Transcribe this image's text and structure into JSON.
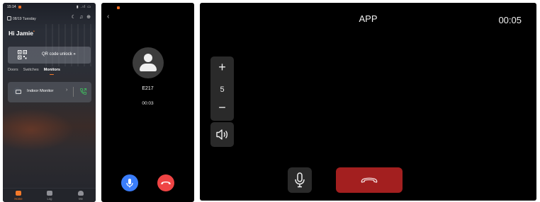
{
  "home": {
    "status_time": "15:14",
    "date": "08/19 Tuesday",
    "greeting": "Hi Jamie",
    "qr_label": "QR code unlock »",
    "tabs": [
      {
        "label": "Doors",
        "active": false
      },
      {
        "label": "Switches",
        "active": false
      },
      {
        "label": "Monitors",
        "active": true
      }
    ],
    "monitor": {
      "name": "Indoor Monitor",
      "chevron": "›"
    },
    "nav": [
      {
        "label": "Home",
        "icon": "home-icon",
        "active": true
      },
      {
        "label": "Log",
        "icon": "log-icon",
        "active": false
      },
      {
        "label": "Me",
        "icon": "person-icon",
        "active": false
      }
    ],
    "accent": "#f47a2a"
  },
  "call_small": {
    "caller": "E217",
    "duration": "00:03",
    "mic_color": "#3a7dfa",
    "end_color": "#ef4444"
  },
  "call_large": {
    "title": "APP",
    "timer": "00:05",
    "volume": "5",
    "plus": "+",
    "minus": "−",
    "hangup_color": "#a31f1f"
  }
}
